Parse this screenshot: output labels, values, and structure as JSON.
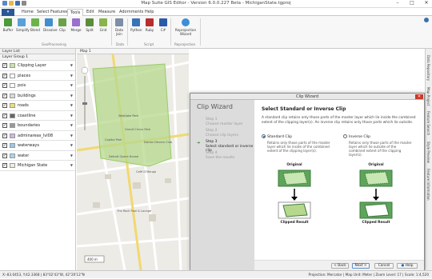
{
  "window": {
    "title": "Map Suite GIS Editor - Version 6.0.0.227 Beta - MichiganState.tgproj",
    "controls": [
      "–",
      "□",
      "✕"
    ]
  },
  "ribbon": {
    "tabs": [
      {
        "label": "Home"
      },
      {
        "label": "Select Features"
      },
      {
        "label": "Tools"
      },
      {
        "label": "Edit"
      },
      {
        "label": "Measure"
      },
      {
        "label": "Adornments"
      },
      {
        "label": "Help"
      }
    ],
    "active_tab": "Tools",
    "buttons": [
      {
        "label": "Buffer",
        "icon": "buffer-icon",
        "color": "#4b9a3c"
      },
      {
        "label": "Simplify",
        "icon": "simplify-icon",
        "color": "#5aa0d8"
      },
      {
        "label": "Blend",
        "icon": "blend-icon",
        "color": "#6cb44a"
      },
      {
        "label": "Dissolve",
        "icon": "dissolve-icon",
        "color": "#3f8fcf"
      },
      {
        "label": "Clip",
        "icon": "clip-icon",
        "color": "#6aa24b"
      },
      {
        "label": "Merge",
        "icon": "merge-icon",
        "color": "#9a6fd0"
      },
      {
        "label": "Split",
        "icon": "split-icon",
        "color": "#5b8e3a"
      },
      {
        "label": "Grid",
        "icon": "grid-icon",
        "color": "#88b34d"
      },
      {
        "label": "Data Join",
        "icon": "data-join-icon",
        "color": "#7d8ea5"
      },
      {
        "label": "Python",
        "icon": "python-icon",
        "color": "#3a72b8"
      },
      {
        "label": "Ruby",
        "icon": "ruby-icon",
        "color": "#b82c2c"
      },
      {
        "label": "C#",
        "icon": "csharp-icon",
        "color": "#2a5ba8"
      },
      {
        "label": "Reprojection Wizard",
        "icon": "globe-icon",
        "color": "#3c8fd6"
      }
    ],
    "groups": [
      {
        "label": "GeoProcessing"
      },
      {
        "label": "Data"
      },
      {
        "label": "Script"
      },
      {
        "label": "Reprojection"
      }
    ]
  },
  "layer_panel": {
    "title": "Layer List",
    "group": "Layer Group 1",
    "layers": [
      {
        "name": "Clipping Layer",
        "checked": true,
        "swatch": "#c9e3a5"
      },
      {
        "name": "places",
        "checked": true,
        "swatch": "#ffffff"
      },
      {
        "name": "pois",
        "checked": true,
        "swatch": "#ffffff"
      },
      {
        "name": "buildings",
        "checked": true,
        "swatch": "#d8d8d8"
      },
      {
        "name": "roads",
        "checked": true,
        "swatch": "#e9e07a"
      },
      {
        "name": "coastline",
        "checked": true,
        "swatch": "#666666"
      },
      {
        "name": "boundaries",
        "checked": true,
        "swatch": "#999999"
      },
      {
        "name": "adminareas_lvl08",
        "checked": true,
        "swatch": "#cdb6e0"
      },
      {
        "name": "waterways",
        "checked": true,
        "swatch": "#9cc7ea"
      },
      {
        "name": "water",
        "checked": true,
        "swatch": "#a9d3f0"
      },
      {
        "name": "Michigan State",
        "checked": true,
        "swatch": "#f1ece0"
      }
    ]
  },
  "map": {
    "tab_label": "Map 1",
    "labels": [
      {
        "text": "Westlake Park"
      },
      {
        "text": "Commonwealth Park"
      },
      {
        "text": "Grand Circus Park"
      },
      {
        "text": "Capitol Park"
      },
      {
        "text": "Detroit Opera House"
      },
      {
        "text": "Dorian Drivers Club"
      },
      {
        "text": "Café D'Mongo"
      },
      {
        "text": "The Rock Pool & Lounge"
      },
      {
        "text": "Flash Kitchen"
      }
    ],
    "scale": "400 m"
  },
  "right_tabs": [
    "Data Repository",
    "Map Project",
    "Feature Search",
    "Style Preview",
    "Feature Information"
  ],
  "wizard": {
    "window_title": "Clip Wizard",
    "heading": "Clip Wizard",
    "steps": [
      {
        "num": "Step 1",
        "label": "Choose master layer"
      },
      {
        "num": "Step 2",
        "label": "Choose clip layers"
      },
      {
        "num": "Step 3",
        "label": "Select standard or inverse clip"
      },
      {
        "num": "Step 4",
        "label": "Save the results"
      }
    ],
    "current_step": 2,
    "page_title": "Select Standard or Inverse Clip",
    "description": "A standard clip retains only those parts of the master layer which lie inside the combined extent of the clipping layer(s). An inverse clip retains only those parts which lie outside.",
    "options": [
      {
        "label": "Standard Clip",
        "selected": true,
        "desc": "Retains only those parts of the master layer which lie inside of the combined extent of the clipping layer(s).",
        "original": "Original",
        "result": "Clipped Result"
      },
      {
        "label": "Inverse Clip",
        "selected": false,
        "desc": "Retains only those parts of the master layer which lie outside of the combined extent of the clipping layer(s).",
        "original": "Original",
        "result": "Clipped Result"
      }
    ],
    "buttons": {
      "back": "< Back",
      "next": "Next >",
      "cancel": "Cancel",
      "help": "Help"
    }
  },
  "status": {
    "coords": "X:-83.0453, Y:42.3368 | 83°02'43\"W, 42°20'12\"N",
    "right": "Projection: Mercator | Map Unit: Meter | Zoom Level: 17 | Scale: 1:4,520"
  }
}
